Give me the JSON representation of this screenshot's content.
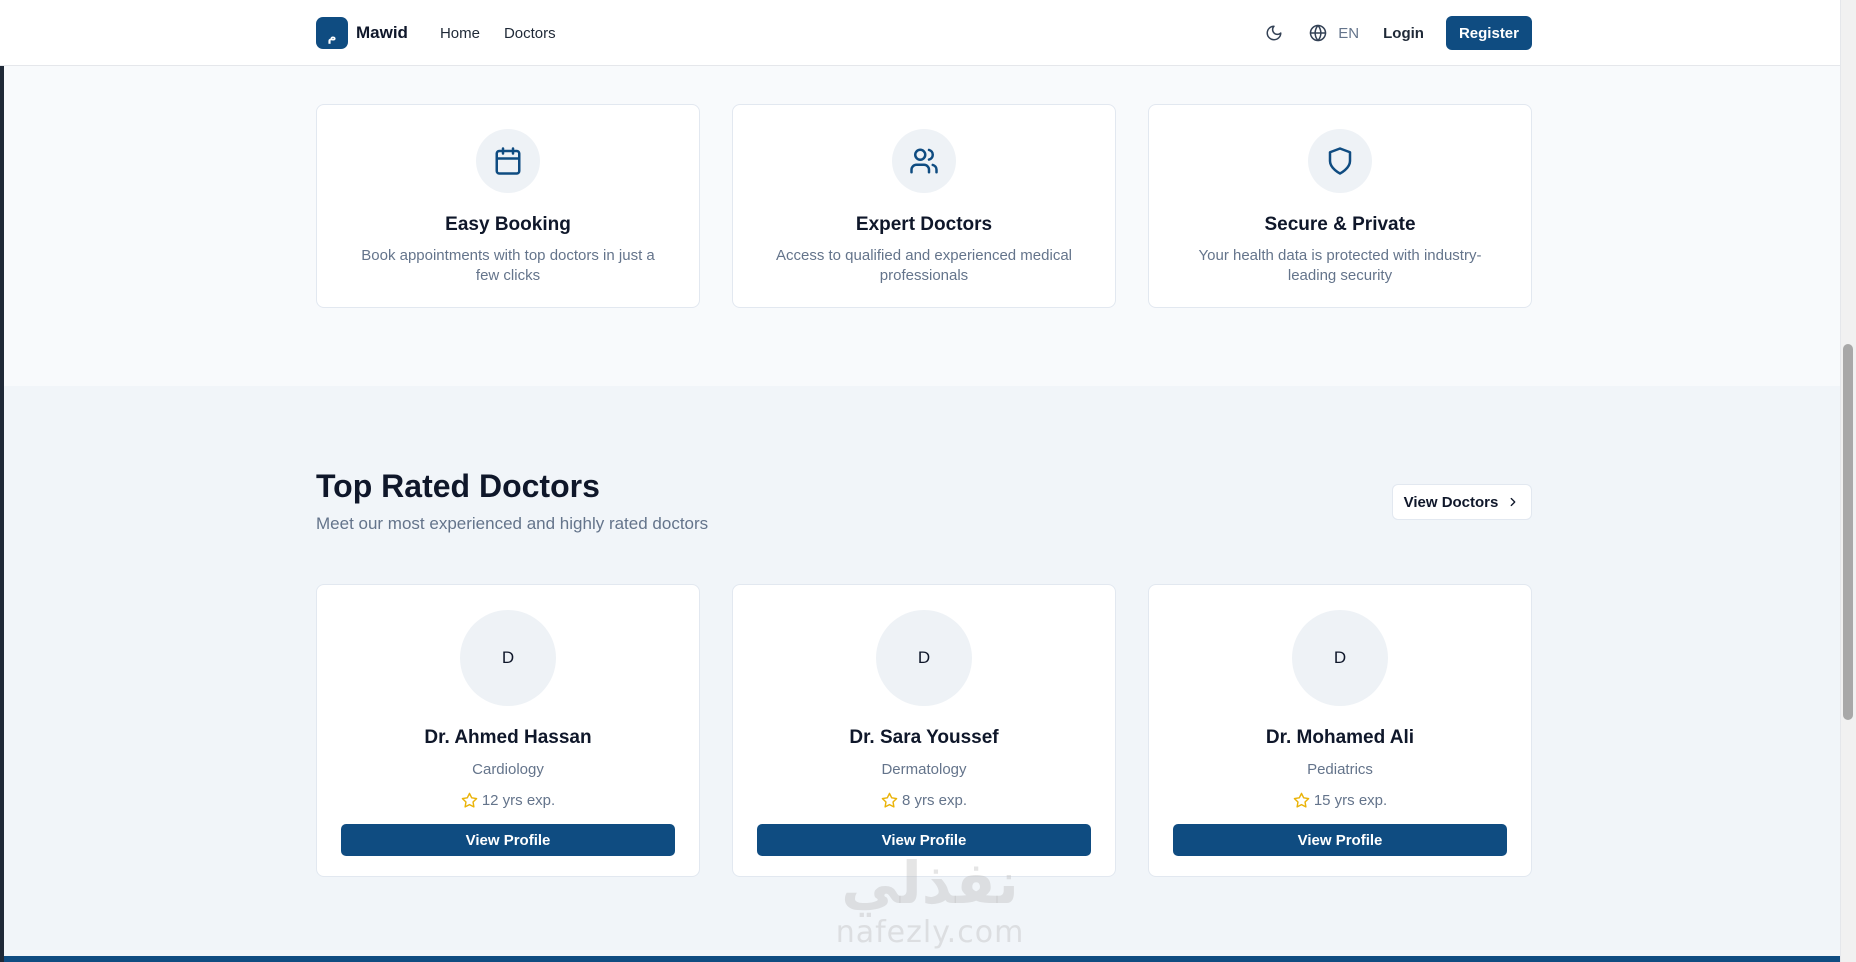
{
  "header": {
    "logo_glyph": "م",
    "brand": "Mawid",
    "nav": [
      "Home",
      "Doctors"
    ],
    "lang_code": "EN",
    "login": "Login",
    "register": "Register"
  },
  "features": [
    {
      "icon": "calendar-icon",
      "title": "Easy Booking",
      "description": "Book appointments with top doctors in just a few clicks"
    },
    {
      "icon": "users-icon",
      "title": "Expert Doctors",
      "description": "Access to qualified and experienced medical professionals"
    },
    {
      "icon": "shield-icon",
      "title": "Secure & Private",
      "description": "Your health data is protected with industry-leading security"
    }
  ],
  "doctors_section": {
    "title": "Top Rated Doctors",
    "subtitle": "Meet our most experienced and highly rated doctors",
    "view_all": "View Doctors"
  },
  "doctors": [
    {
      "initial": "D",
      "name": "Dr. Ahmed Hassan",
      "specialty": "Cardiology",
      "experience": "12 yrs exp.",
      "button": "View Profile"
    },
    {
      "initial": "D",
      "name": "Dr. Sara Youssef",
      "specialty": "Dermatology",
      "experience": "8 yrs exp.",
      "button": "View Profile"
    },
    {
      "initial": "D",
      "name": "Dr. Mohamed Ali",
      "specialty": "Pediatrics",
      "experience": "15 yrs exp.",
      "button": "View Profile"
    }
  ],
  "watermark": {
    "arabic": "نفذلي",
    "latin": "nafezly.com"
  },
  "colors": {
    "primary": "#0f4c81",
    "star": "#eab308",
    "muted": "#64748b"
  }
}
